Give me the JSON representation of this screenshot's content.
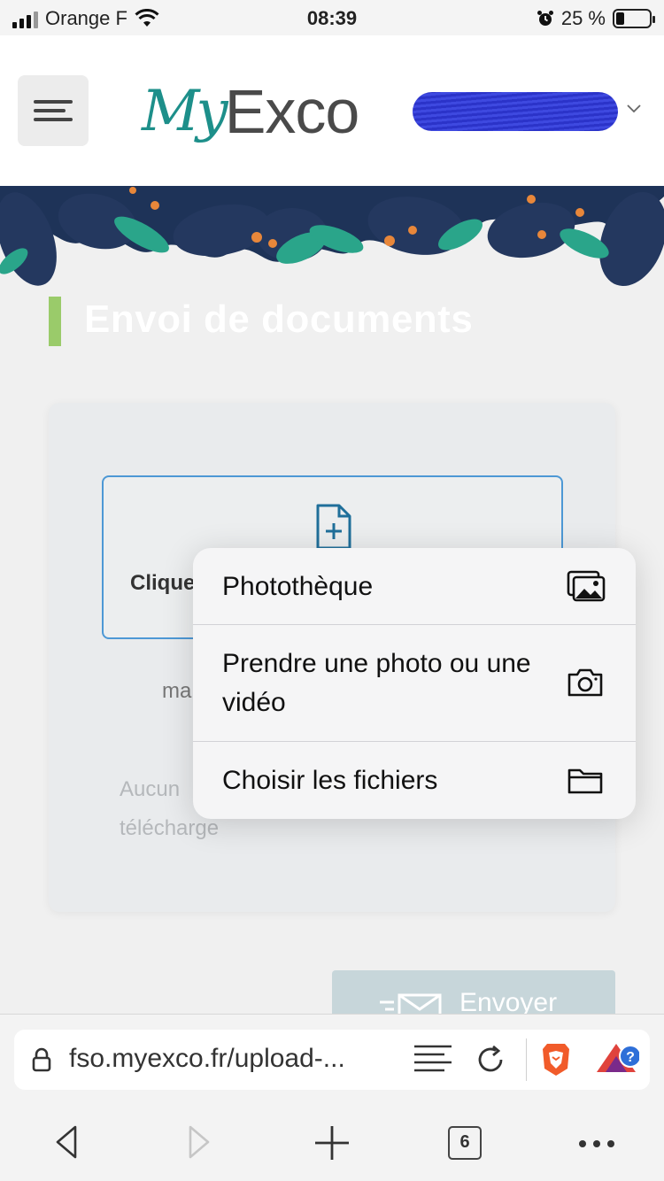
{
  "status_bar": {
    "carrier": "Orange F",
    "time": "08:39",
    "battery": "25 %",
    "battery_level": 0.25
  },
  "header": {
    "logo_my": "My",
    "logo_exco": "Exco"
  },
  "page": {
    "title": "Envoi de documents"
  },
  "upload": {
    "click_label": "Clique",
    "max_label": "ma",
    "none_line1": "Aucun",
    "none_line2": "télécharge"
  },
  "send_button": {
    "label": "Envoyer"
  },
  "action_sheet": {
    "items": [
      {
        "label": "Photothèque",
        "icon": "photo-library-icon"
      },
      {
        "label": "Prendre une photo ou une vidéo",
        "icon": "camera-icon"
      },
      {
        "label": "Choisir les fichiers",
        "icon": "folder-icon"
      }
    ]
  },
  "browser": {
    "url": "fso.myexco.fr/upload-...",
    "tab_count": "6"
  }
}
